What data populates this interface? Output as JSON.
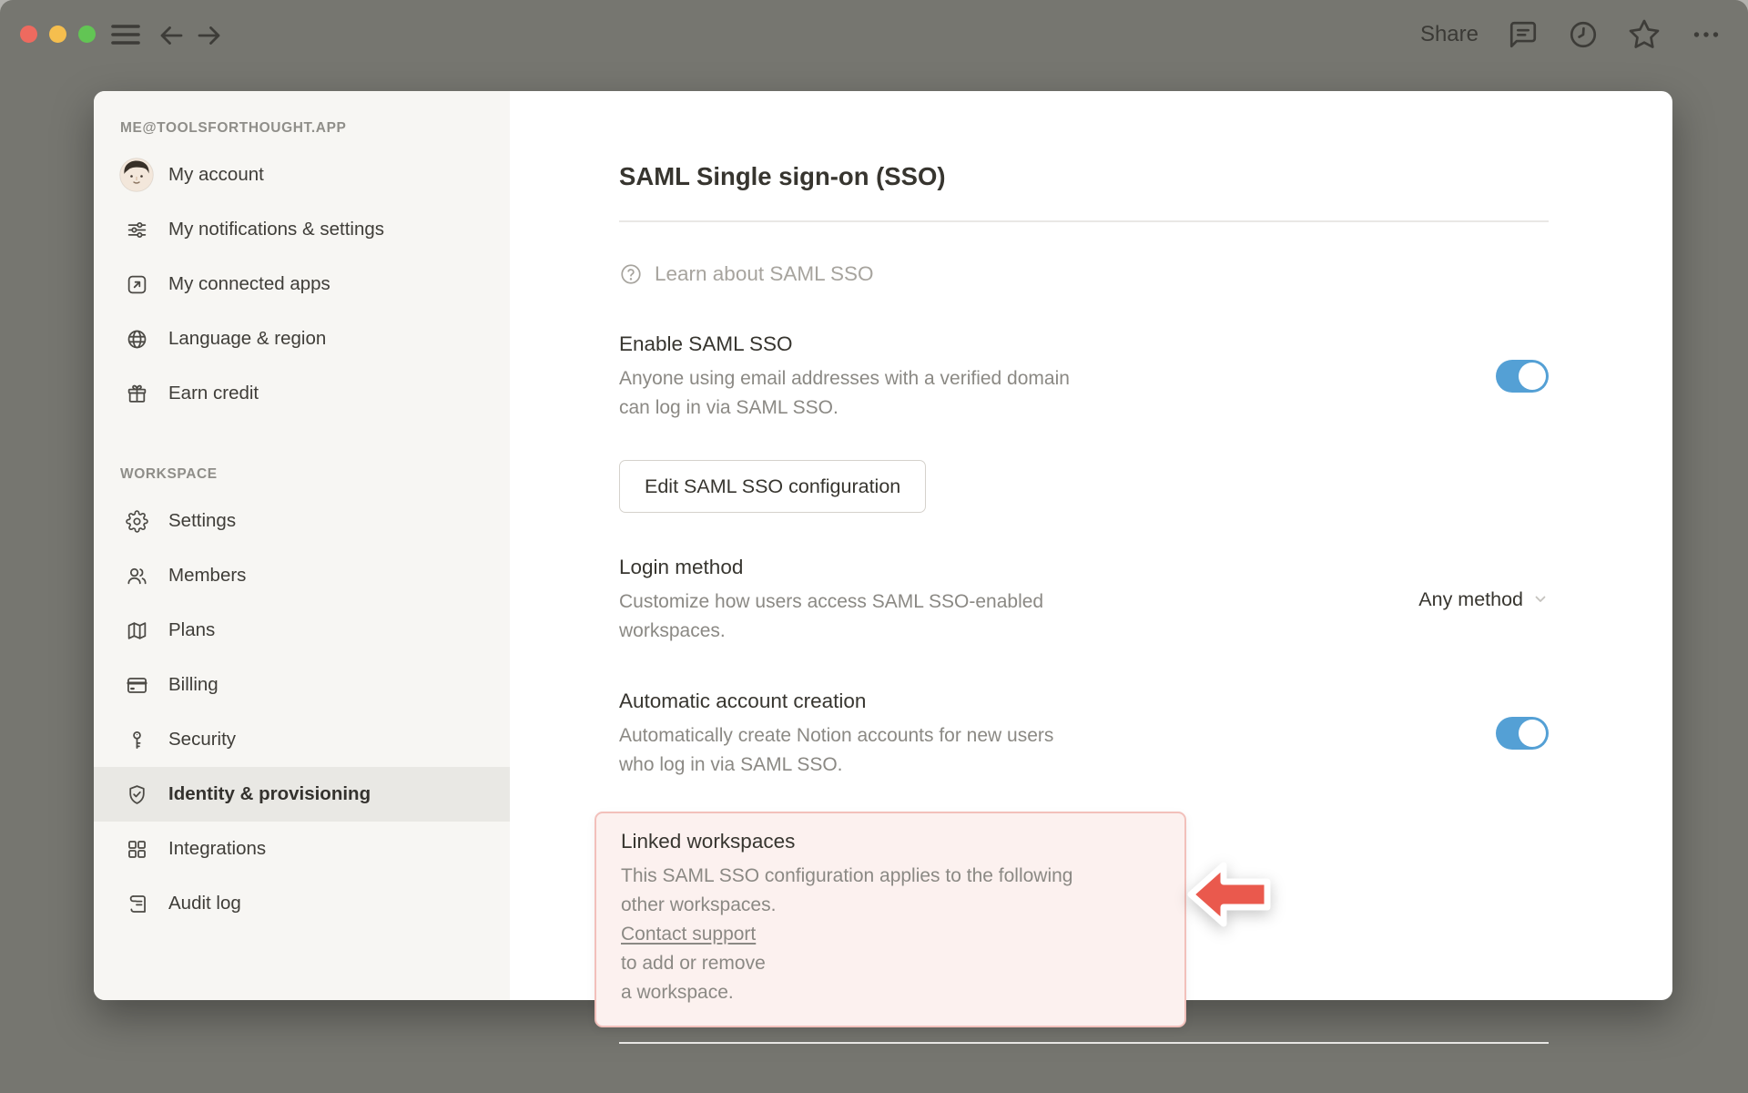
{
  "browser": {
    "share_label": "Share"
  },
  "sidebar": {
    "account_header": "ME@TOOLSFORTHOUGHT.APP",
    "account_items": [
      {
        "label": "My account",
        "icon": "avatar"
      },
      {
        "label": "My notifications & settings",
        "icon": "sliders-icon"
      },
      {
        "label": "My connected apps",
        "icon": "arrow-up-right-square-icon"
      },
      {
        "label": "Language & region",
        "icon": "globe-icon"
      },
      {
        "label": "Earn credit",
        "icon": "gift-icon"
      }
    ],
    "workspace_header": "WORKSPACE",
    "workspace_items": [
      {
        "label": "Settings",
        "icon": "gear-icon"
      },
      {
        "label": "Members",
        "icon": "members-icon"
      },
      {
        "label": "Plans",
        "icon": "map-icon"
      },
      {
        "label": "Billing",
        "icon": "credit-card-icon"
      },
      {
        "label": "Security",
        "icon": "key-icon"
      },
      {
        "label": "Identity & provisioning",
        "icon": "shield-check-icon",
        "selected": true
      },
      {
        "label": "Integrations",
        "icon": "grid-icon"
      },
      {
        "label": "Audit log",
        "icon": "audit-log-icon"
      }
    ]
  },
  "main": {
    "title": "SAML Single sign-on (SSO)",
    "learn_label": "Learn about SAML SSO",
    "enable": {
      "heading": "Enable SAML SSO",
      "description_line1": "Anyone using email addresses with a verified domain",
      "description_line2": "can log in via SAML SSO.",
      "toggle_on": true
    },
    "edit_button_label": "Edit SAML SSO configuration",
    "login_method": {
      "heading": "Login method",
      "description_line1": "Customize how users access SAML SSO-enabled",
      "description_line2": "workspaces.",
      "value": "Any method"
    },
    "auto_account": {
      "heading": "Automatic account creation",
      "description_line1": "Automatically create Notion accounts for new users",
      "description_line2": "who log in via SAML SSO.",
      "toggle_on": true
    },
    "linked_workspaces": {
      "heading": "Linked workspaces",
      "line1": "This SAML SSO configuration applies to the following",
      "line2_before_link": "other workspaces. ",
      "link_text": "Contact support",
      "line2_after_link": " to add or remove",
      "line3": "a workspace."
    }
  },
  "colors": {
    "toggle_on_blue": "#54a0d5",
    "highlight_box_bg": "#fcf1ef",
    "highlight_box_border": "#f2c0bb",
    "annotation_arrow_red": "#ea594d",
    "traffic_red": "#ee6a5f",
    "traffic_yellow": "#f5be4e",
    "traffic_green": "#62c554"
  }
}
